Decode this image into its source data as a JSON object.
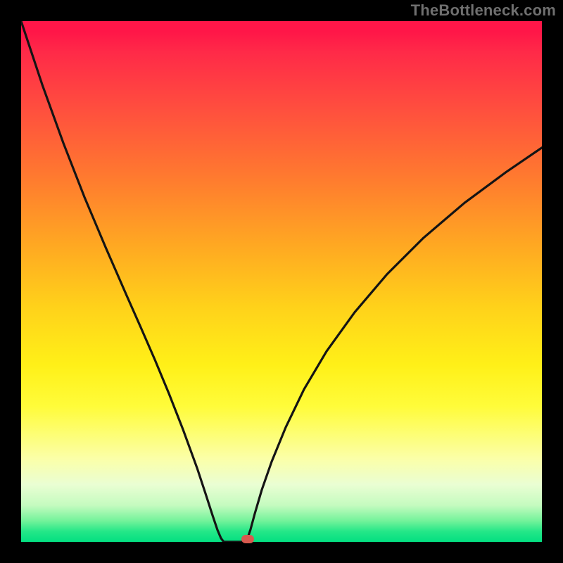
{
  "watermark": {
    "text": "TheBottleneck.com"
  },
  "colors": {
    "frame": "#000000",
    "curve_stroke": "#141414",
    "marker_fill": "#d85a4f",
    "gradient_top": "#ff1648",
    "gradient_bottom": "#03df81"
  },
  "chart_data": {
    "type": "line",
    "title": "",
    "xlabel": "",
    "ylabel": "",
    "xlim": [
      0,
      740
    ],
    "ylim_percent": [
      0,
      100
    ],
    "legend": false,
    "grid": false,
    "series": [
      {
        "name": "curve",
        "x": [
          0,
          30,
          60,
          90,
          120,
          150,
          170,
          190,
          210,
          230,
          250,
          262,
          272,
          279,
          284,
          288,
          292,
          296,
          300,
          310,
          321,
          322,
          326,
          332,
          342,
          356,
          376,
          402,
          434,
          474,
          520,
          572,
          630,
          690,
          740
        ],
        "y_percent": [
          100,
          87.8,
          76.6,
          66.2,
          56.6,
          47.3,
          41.2,
          35.0,
          28.5,
          21.6,
          14.2,
          9.3,
          5.1,
          2.3,
          0.7,
          0.0,
          0.0,
          0.0,
          0.0,
          0.0,
          0.0,
          0.8,
          2.4,
          5.4,
          10.0,
          15.4,
          22.0,
          29.3,
          36.6,
          44.1,
          51.4,
          58.4,
          65.1,
          71.1,
          75.7
        ]
      }
    ],
    "marker": {
      "x": 322,
      "y_percent": 0.6
    }
  }
}
